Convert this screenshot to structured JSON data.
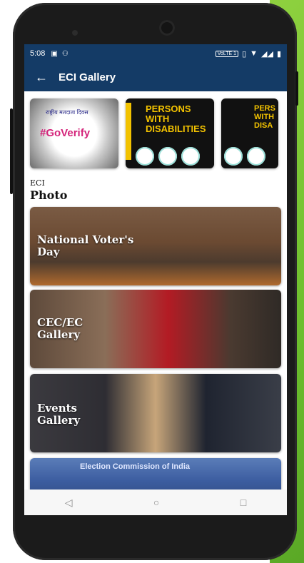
{
  "status_bar": {
    "time": "5:08",
    "volte": "VoLTE 1"
  },
  "app_bar": {
    "back_icon": "arrow-left-icon",
    "title": "ECI Gallery"
  },
  "carousel": [
    {
      "name": "GoVerify banner",
      "top_text": "राष्ट्रीय मतदाता दिवस",
      "main_text": "#GoVerify"
    },
    {
      "name": "Persons with Disabilities banner",
      "main_text": "PERSONS WITH DISABILITIES"
    },
    {
      "name": "Persons with Disabilities banner 2",
      "main_text": "PERS WITH DISA"
    }
  ],
  "section": {
    "small": "ECI",
    "large": "Photo"
  },
  "tiles": [
    {
      "label": "National Voter's Day"
    },
    {
      "label": "CEC/EC Gallery"
    },
    {
      "label": "Events Gallery"
    },
    {
      "label": "",
      "banner": "Election Commission of India"
    }
  ],
  "nav_bar": {
    "back": "◁",
    "home": "○",
    "recents": "□"
  },
  "colors": {
    "app_bar": "#143b66",
    "background_accent": "#8fd13f"
  }
}
